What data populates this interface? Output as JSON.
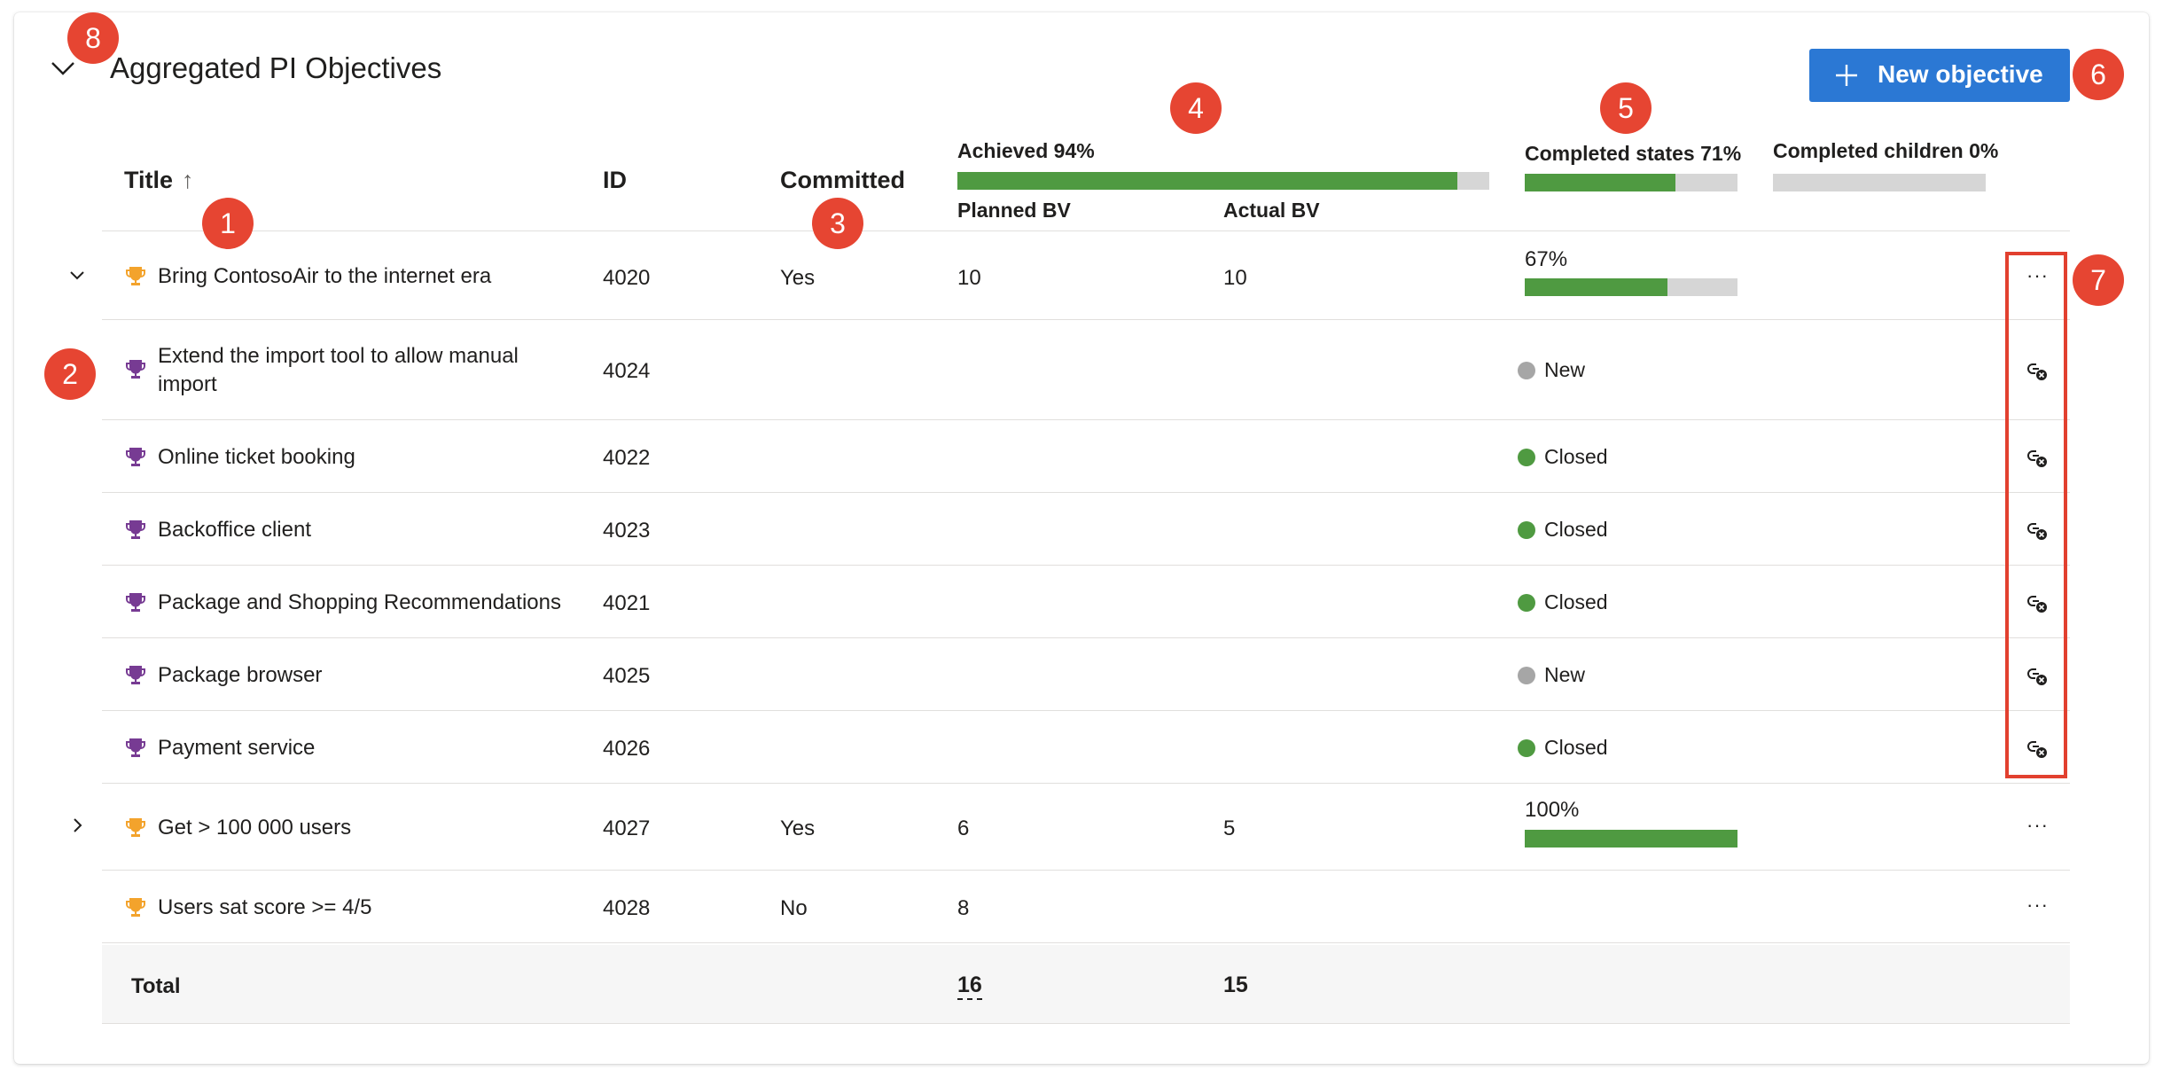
{
  "section": {
    "title": "Aggregated PI Objectives"
  },
  "toolbar": {
    "new_objective_label": "New objective"
  },
  "header": {
    "title": "Title",
    "sort_indicator": "↑",
    "id": "ID",
    "committed": "Committed",
    "achieved_label": "Achieved 94%",
    "achieved_fraction": 0.94,
    "planned_bv": "Planned BV",
    "actual_bv": "Actual BV",
    "completed_states_label": "Completed states 71%",
    "completed_states_fraction": 0.71,
    "completed_children_label": "Completed children 0%",
    "completed_children_fraction": 0.0
  },
  "rows": [
    {
      "title": "Bring ContosoAir to the internet era",
      "id": "4020",
      "committed": "Yes",
      "planned_bv": "10",
      "actual_bv": "10",
      "progress_label": "67%",
      "progress_fraction": 0.67,
      "expanded": true,
      "more": "···"
    },
    {
      "title": "Extend the import tool to allow manual import",
      "id": "4024",
      "state": "New"
    },
    {
      "title": "Online ticket booking",
      "id": "4022",
      "state": "Closed"
    },
    {
      "title": "Backoffice client",
      "id": "4023",
      "state": "Closed"
    },
    {
      "title": "Package and Shopping Recommendations",
      "id": "4021",
      "state": "Closed"
    },
    {
      "title": "Package browser",
      "id": "4025",
      "state": "New"
    },
    {
      "title": "Payment service",
      "id": "4026",
      "state": "Closed"
    },
    {
      "title": "Get > 100 000 users",
      "id": "4027",
      "committed": "Yes",
      "planned_bv": "6",
      "actual_bv": "5",
      "progress_label": "100%",
      "progress_fraction": 1.0,
      "expanded": false,
      "more": "···"
    },
    {
      "title": "Users sat score >= 4/5",
      "id": "4028",
      "committed": "No",
      "planned_bv": "8",
      "more": "···"
    }
  ],
  "total": {
    "label": "Total",
    "planned_bv": "16",
    "actual_bv": "15"
  },
  "badges": [
    "1",
    "2",
    "3",
    "4",
    "5",
    "6",
    "7",
    "8"
  ],
  "colors": {
    "accent": "#2b78d4",
    "progress_fill": "#4f9a41",
    "progress_track": "#d6d6d6",
    "state_new": "#a6a6a6",
    "state_closed": "#4f9a41",
    "trophy_parent": "#f3a32c",
    "trophy_child": "#773b93",
    "callout": "#e64532"
  }
}
